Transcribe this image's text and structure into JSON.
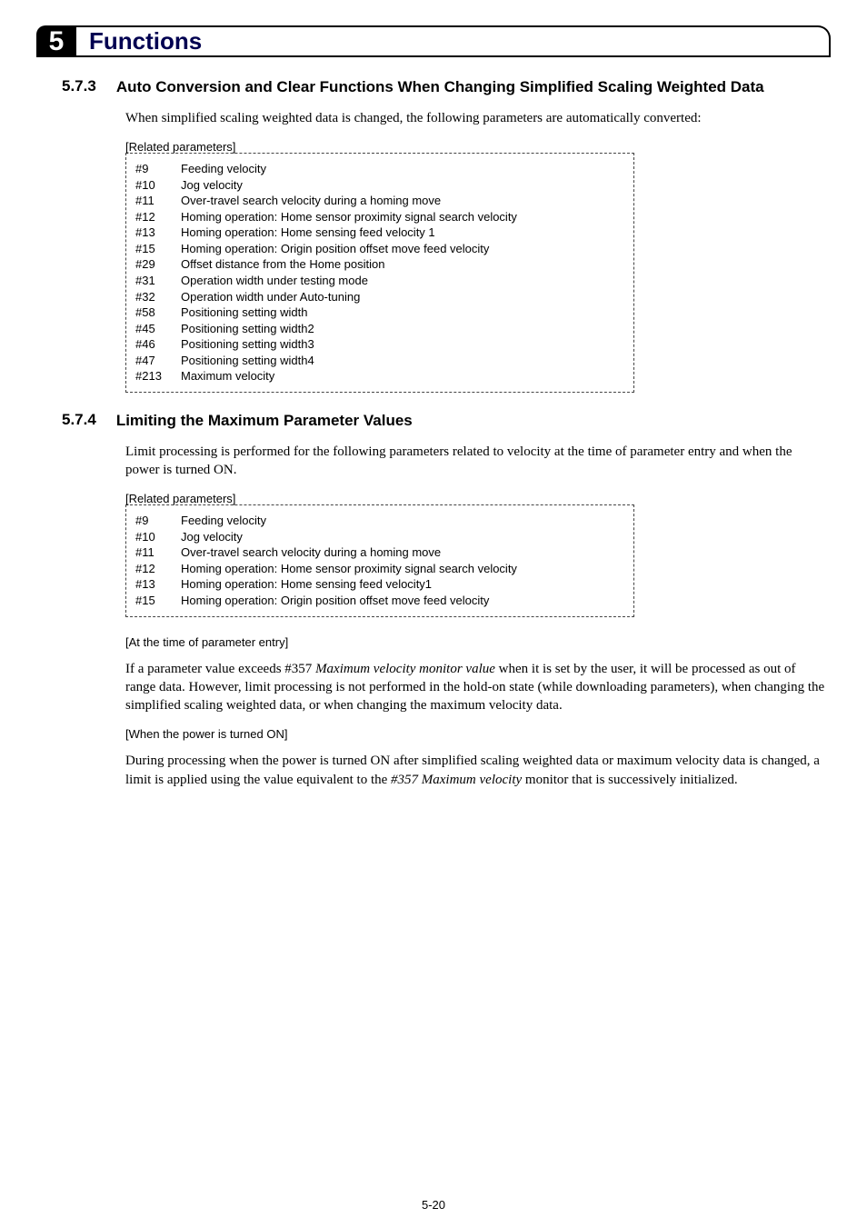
{
  "chapter": {
    "number": "5",
    "title": "Functions"
  },
  "section_573": {
    "number": "5.7.3",
    "title": "Auto Conversion and Clear Functions When Changing Simplified Scaling Weighted Data",
    "body": "When simplified scaling weighted data is changed, the following parameters are automatically converted:",
    "related_label": "[Related parameters]",
    "params": [
      {
        "id": "#9",
        "desc": "Feeding velocity"
      },
      {
        "id": "#10",
        "desc": "Jog velocity"
      },
      {
        "id": "#11",
        "desc": "Over-travel search velocity during a homing move"
      },
      {
        "id": "#12",
        "desc": "Homing operation: Home sensor proximity signal search velocity"
      },
      {
        "id": "#13",
        "desc": "Homing operation: Home sensing feed velocity 1"
      },
      {
        "id": "#15",
        "desc": "Homing operation: Origin position offset move feed velocity"
      },
      {
        "id": "#29",
        "desc": "Offset distance from the Home position"
      },
      {
        "id": "#31",
        "desc": "Operation width under testing mode"
      },
      {
        "id": "#32",
        "desc": "Operation width under Auto-tuning"
      },
      {
        "id": "#58",
        "desc": "Positioning setting width"
      },
      {
        "id": "#45",
        "desc": "Positioning setting width2"
      },
      {
        "id": "#46",
        "desc": "Positioning setting width3"
      },
      {
        "id": "#47",
        "desc": "Positioning setting width4"
      },
      {
        "id": "#213",
        "desc": "Maximum velocity"
      }
    ]
  },
  "section_574": {
    "number": "5.7.4",
    "title": "Limiting the Maximum Parameter Values",
    "body": "Limit processing is performed for the following parameters related to velocity at the time of parameter entry and when the power is turned ON.",
    "related_label": "[Related parameters]",
    "params": [
      {
        "id": "#9",
        "desc": "Feeding velocity"
      },
      {
        "id": "#10",
        "desc": "Jog velocity"
      },
      {
        "id": "#11",
        "desc": "Over-travel search velocity during a homing move"
      },
      {
        "id": "#12",
        "desc": "Homing operation: Home sensor proximity signal search velocity"
      },
      {
        "id": "#13",
        "desc": "Homing operation: Home sensing feed velocity1"
      },
      {
        "id": "#15",
        "desc": "Homing operation: Origin position offset move feed velocity"
      }
    ],
    "sub1_label": "[At the time of parameter entry]",
    "sub1_body_before": "If a parameter value exceeds #357 ",
    "sub1_body_em": "Maximum velocity monitor value",
    "sub1_body_after": " when it is set by the user, it will be processed as out of range data. However, limit processing is not performed in the hold-on state (while downloading parameters), when changing the simplified scaling weighted data, or when changing the maximum velocity data.",
    "sub2_label": "[When the power is turned ON]",
    "sub2_body_before": "During processing when the power is turned ON after simplified scaling weighted data or maximum velocity data is changed, a limit is applied using the value equivalent to the ",
    "sub2_body_em": "#357 Maximum velocity",
    "sub2_body_after": " monitor that is successively initialized."
  },
  "page_number": "5-20"
}
